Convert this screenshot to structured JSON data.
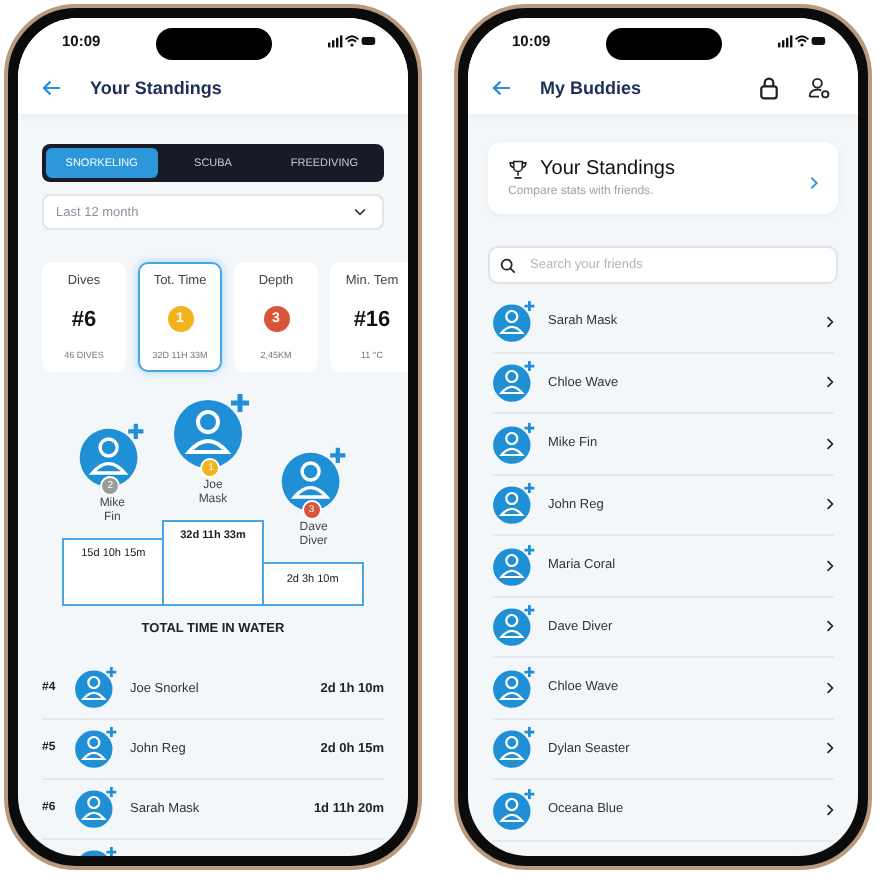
{
  "standings_screen": {
    "status_bar": {
      "time": "10:09"
    },
    "header": {
      "title": "Your Standings"
    },
    "tabs": [
      {
        "label": "SNORKELING",
        "selected": true
      },
      {
        "label": "SCUBA",
        "selected": false
      },
      {
        "label": "FREEDIVING",
        "selected": false
      }
    ],
    "period_select": {
      "value": "Last 12 month"
    },
    "stat_cards": [
      {
        "title": "Dives",
        "kind": "rank",
        "value": "#6",
        "detail": "46 DIVES",
        "selected": false
      },
      {
        "title": "Tot. Time",
        "kind": "medal",
        "value": "1",
        "color": "#f2b31c",
        "detail": "32D 11H 33M",
        "selected": true
      },
      {
        "title": "Depth",
        "kind": "medal",
        "value": "3",
        "color": "#d8553a",
        "detail": "2,45KM",
        "selected": false
      },
      {
        "title": "Min. Tem",
        "kind": "rank",
        "value": "#16",
        "detail": "11 °C",
        "selected": false
      }
    ],
    "podium": [
      {
        "name": "Mike Fin",
        "place": "2",
        "color": "#9b9b9b",
        "time": "15d 10h 15m"
      },
      {
        "name": "Joe Mask",
        "place": "1",
        "color": "#f2b31c",
        "time": "32d 11h 33m"
      },
      {
        "name": "Dave Diver",
        "place": "3",
        "color": "#d8553a",
        "time": "2d 3h 10m"
      }
    ],
    "podium_caption": "TOTAL TIME IN WATER",
    "ranking": [
      {
        "rank": "#4",
        "name": "Joe Snorkel",
        "time": "2d 1h 10m"
      },
      {
        "rank": "#5",
        "name": "John Reg",
        "time": "2d 0h 15m"
      },
      {
        "rank": "#6",
        "name": "Sarah Mask",
        "time": "1d 11h 20m"
      }
    ]
  },
  "buddies_screen": {
    "status_bar": {
      "time": "10:09"
    },
    "header": {
      "title": "My Buddies"
    },
    "standings_card": {
      "title": "Your Standings",
      "subtitle": "Compare stats with friends."
    },
    "search": {
      "placeholder": "Search your friends"
    },
    "buddies": [
      "Sarah Mask",
      "Chloe Wave",
      "Mike Fin",
      "John Reg",
      "Maria Coral",
      "Dave Diver",
      "Chloe Wave",
      "Dylan Seaster",
      "Oceana Blue"
    ]
  }
}
